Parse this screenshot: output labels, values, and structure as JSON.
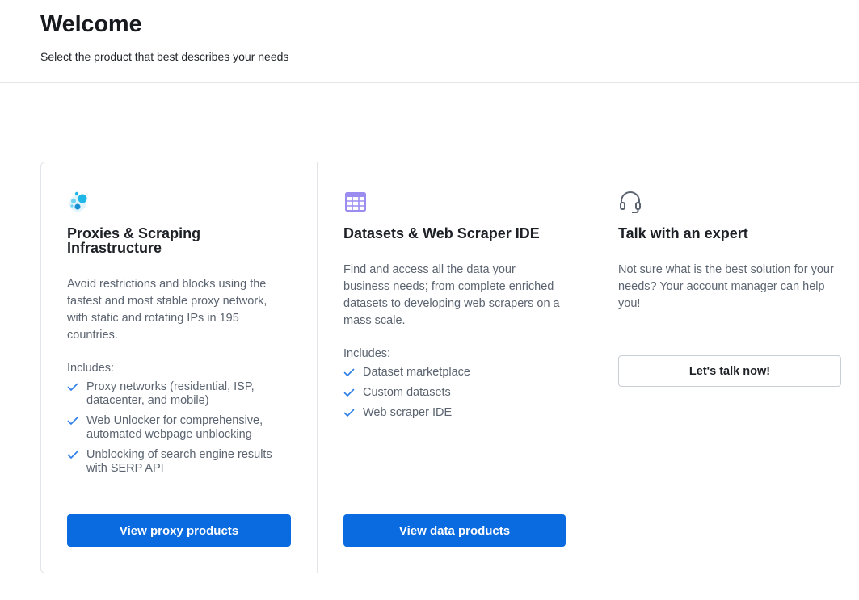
{
  "header": {
    "title": "Welcome",
    "subtitle": "Select the product that best describes your needs"
  },
  "colors": {
    "primary": "#0a6ae0",
    "check": "#2b7de9",
    "proxy_icon": "#1fb6e8",
    "dataset_icon": "#9b8cf0"
  },
  "cards": [
    {
      "icon": "proxy-network-icon",
      "title": "Proxies & Scraping Infrastructure",
      "description": "Avoid restrictions and blocks using the fastest and most stable proxy network, with static and rotating IPs in 195 countries.",
      "includes_label": "Includes:",
      "features": [
        "Proxy networks (residential, ISP, datacenter, and mobile)",
        "Web Unlocker for comprehensive, automated webpage unblocking",
        "Unblocking of search engine results with SERP API"
      ],
      "button_label": "View proxy products"
    },
    {
      "icon": "dataset-table-icon",
      "title": "Datasets & Web Scraper IDE",
      "description": "Find and access all the data your business needs; from complete enriched datasets to developing web scrapers on a mass scale.",
      "includes_label": "Includes:",
      "features": [
        "Dataset marketplace",
        "Custom datasets",
        "Web scraper IDE"
      ],
      "button_label": "View data products"
    },
    {
      "icon": "headset-icon",
      "title": "Talk with an expert",
      "description": "Not sure what is the best solution for your needs? Your account manager can help you!",
      "button_label": "Let's talk now!"
    }
  ]
}
